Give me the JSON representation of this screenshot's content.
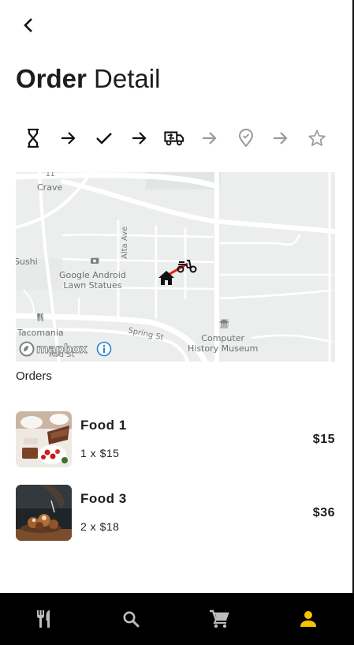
{
  "header": {
    "back_icon": "chevron-left-icon",
    "title_bold": "Order",
    "title_light": "Detail"
  },
  "tracker": {
    "steps": [
      {
        "icon": "hourglass-icon",
        "active": true
      },
      {
        "icon": "arrow-right-icon",
        "active": true
      },
      {
        "icon": "check-icon",
        "active": true
      },
      {
        "icon": "arrow-right-icon",
        "active": true
      },
      {
        "icon": "delivery-truck-icon",
        "active": true
      },
      {
        "icon": "arrow-right-icon",
        "active": false
      },
      {
        "icon": "location-check-icon",
        "active": false
      },
      {
        "icon": "arrow-right-icon",
        "active": false
      },
      {
        "icon": "star-icon",
        "active": false
      }
    ],
    "active_color": "#111111",
    "inactive_color": "#9a9a9a"
  },
  "map": {
    "labels": {
      "crave": "Crave",
      "sushi": "Sushi",
      "google_android": "Google Android",
      "lawn_statues": "Lawn Statues",
      "tacomania": "Tacomania",
      "computer": "Computer",
      "history_museum": "History Museum",
      "alta_ave": "Alta Ave",
      "spring_st": "Spring St",
      "road_num": "11",
      "rodst": "Rod St"
    },
    "attribution": "mapbox",
    "markers": {
      "home_icon": "home-icon",
      "scooter_icon": "scooter-icon",
      "route_color": "#e31b1b"
    }
  },
  "orders": {
    "section_label": "Orders",
    "items": [
      {
        "name": "Food 1",
        "qty": "1 x $15",
        "price": "$15"
      },
      {
        "name": "Food 3",
        "qty": "2 x $18",
        "price": "$36"
      }
    ]
  },
  "bottom_nav": {
    "items": [
      {
        "icon": "restaurant-icon",
        "active": false
      },
      {
        "icon": "search-icon",
        "active": false
      },
      {
        "icon": "cart-icon",
        "active": false
      },
      {
        "icon": "person-icon",
        "active": true
      }
    ],
    "active_color": "#f5c400",
    "inactive_color": "#bdbdbd",
    "background": "#000000"
  }
}
